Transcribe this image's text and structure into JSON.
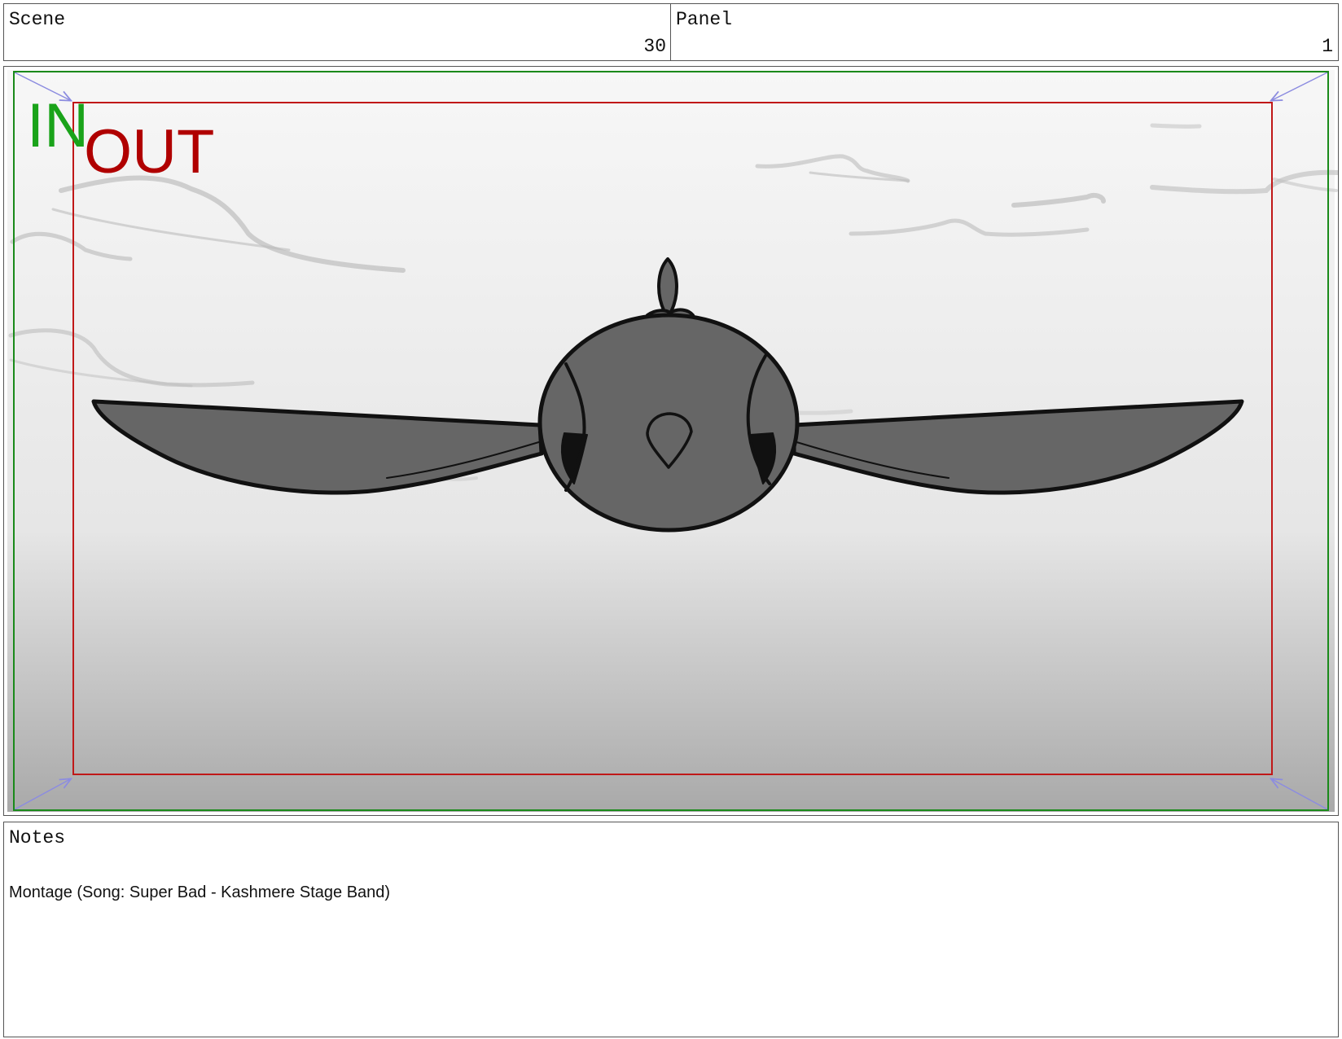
{
  "header": {
    "scene_label": "Scene",
    "scene_value": "30",
    "panel_label": "Panel",
    "panel_value": "1"
  },
  "frame": {
    "in_label": "IN",
    "out_label": "OUT",
    "in_color": "#1aa31a",
    "out_color": "#b00000",
    "arrow_color": "#8c8ce0",
    "illustration": "bird-flying-front-view"
  },
  "notes": {
    "label": "Notes",
    "text": "Montage (Song: Super Bad - Kashmere Stage Band)"
  }
}
